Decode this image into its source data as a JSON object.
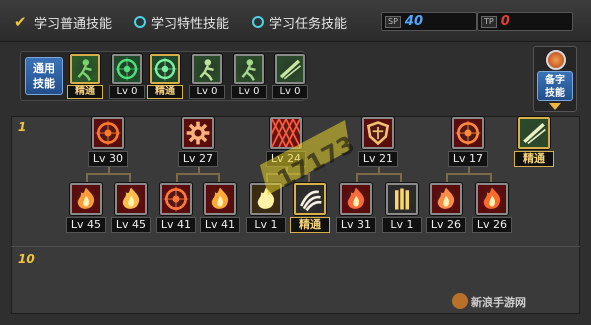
{
  "tabs": [
    {
      "label": "学习普通技能",
      "selected": true
    },
    {
      "label": "学习特性技能",
      "selected": false
    },
    {
      "label": "学习任务技能",
      "selected": false
    }
  ],
  "counters": [
    {
      "badge": "SP",
      "value": "40",
      "color": "#4fa8ff"
    },
    {
      "badge": "TP",
      "value": "0",
      "color": "#e2413a"
    }
  ],
  "general": {
    "label": "通用\n技能",
    "skills": [
      {
        "level": "精通",
        "gold": true,
        "icon": "runner-icon"
      },
      {
        "level": "Lv 0",
        "gold": false,
        "icon": "crosshair-icon"
      },
      {
        "level": "精通",
        "gold": true,
        "icon": "target-icon"
      },
      {
        "level": "Lv 0",
        "gold": false,
        "icon": "figure-icon"
      },
      {
        "level": "Lv 0",
        "gold": false,
        "icon": "pet-icon"
      },
      {
        "level": "Lv 0",
        "gold": false,
        "icon": "strike-icon"
      }
    ]
  },
  "side_button": {
    "label": "备字\n技能"
  },
  "tree": {
    "rows": [
      "1",
      "10"
    ],
    "top_skills": [
      {
        "level": "Lv 30",
        "gold": false,
        "icon": "fire-ring-icon"
      },
      {
        "level": "Lv 27",
        "gold": false,
        "icon": "gear-burst-icon"
      },
      {
        "level": "Lv 24",
        "gold": false,
        "icon": "grid-icon"
      },
      {
        "level": "Lv 21",
        "gold": false,
        "icon": "shield-icon"
      },
      {
        "level": "Lv 17",
        "gold": false,
        "icon": "swirl-icon"
      },
      {
        "level": "精通",
        "gold": true,
        "icon": "slash-icon"
      }
    ],
    "bottom_skills": [
      {
        "level": "Lv 45",
        "gold": false,
        "icon": "flame-icon"
      },
      {
        "level": "Lv 45",
        "gold": false,
        "icon": "fire-arrow-icon"
      },
      {
        "level": "Lv 41",
        "gold": false,
        "icon": "fire-wheel-icon"
      },
      {
        "level": "Lv 41",
        "gold": false,
        "icon": "blaze-icon"
      },
      {
        "level": "Lv 1",
        "gold": false,
        "icon": "spark-icon"
      },
      {
        "level": "精通",
        "gold": true,
        "icon": "claw-icon"
      },
      {
        "level": "Lv 31",
        "gold": false,
        "icon": "dragon-icon"
      },
      {
        "level": "Lv 1",
        "gold": false,
        "icon": "pillar-icon"
      },
      {
        "level": "Lv 26",
        "gold": false,
        "icon": "ember-icon"
      },
      {
        "level": "Lv 26",
        "gold": false,
        "icon": "phoenix-icon"
      }
    ]
  },
  "watermark_logo": "17173",
  "watermark_text": "新浪手游网"
}
